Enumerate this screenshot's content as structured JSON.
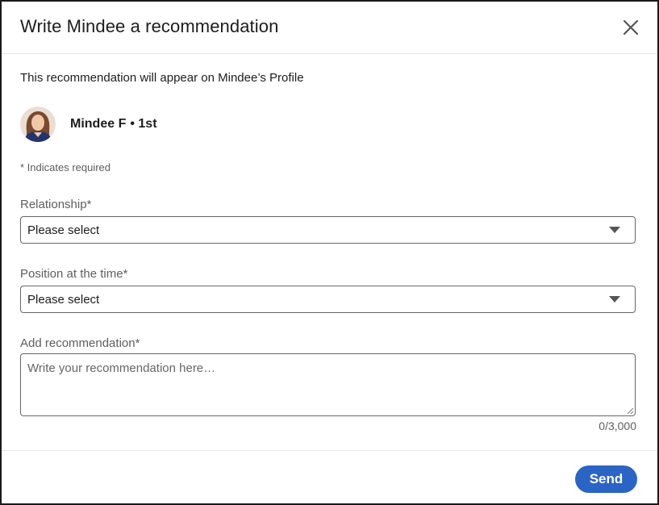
{
  "dialog": {
    "title": "Write Mindee a recommendation",
    "close_icon": "close-icon"
  },
  "intro_text": "This recommendation will appear on Mindee’s Profile",
  "person": {
    "name": "Mindee F",
    "degree": "• 1st",
    "avatar_icon": "avatar-photo"
  },
  "required_note": "* Indicates required",
  "fields": {
    "relationship": {
      "label": "Relationship*",
      "value": "Please select"
    },
    "position": {
      "label": "Position at the time*",
      "value": "Please select"
    },
    "recommendation": {
      "label": "Add recommendation*",
      "placeholder": "Write your recommendation here…",
      "counter": "0/3,000"
    }
  },
  "footer": {
    "send_label": "Send"
  },
  "colors": {
    "primary": "#2a64c5",
    "border": "#666666",
    "muted_text": "#5e5e5e"
  }
}
